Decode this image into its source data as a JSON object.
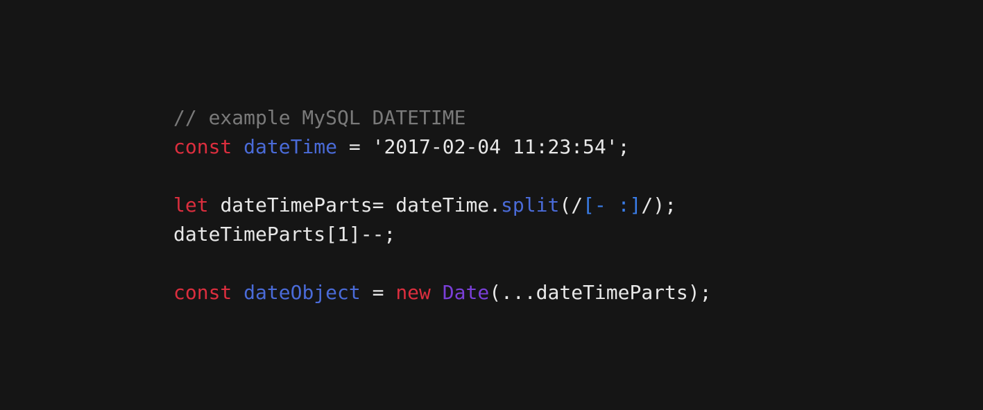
{
  "code": {
    "line1": {
      "comment": "// example MySQL DATETIME"
    },
    "line2": {
      "keyword": "const",
      "space1": " ",
      "ident": "dateTime",
      "assign": " = ",
      "string": "'2017-02-04 11:23:54'",
      "semi": ";"
    },
    "line3": "",
    "line4": {
      "keyword": "let",
      "space1": " ",
      "ident": "dateTimeParts",
      "assign": "= dateTime.",
      "method": "split",
      "paren_open": "(",
      "regex_open": "/",
      "regex_class": "[- :]",
      "regex_close": "/",
      "paren_close": ")",
      "semi": ";"
    },
    "line5": {
      "text": "dateTimeParts[1]--;"
    },
    "line6": "",
    "line7": {
      "keyword": "const",
      "space1": " ",
      "ident": "dateObject",
      "assign": " = ",
      "new_kw": "new",
      "space2": " ",
      "classname": "Date",
      "args": "(...dateTimeParts)",
      "semi": ";"
    }
  }
}
